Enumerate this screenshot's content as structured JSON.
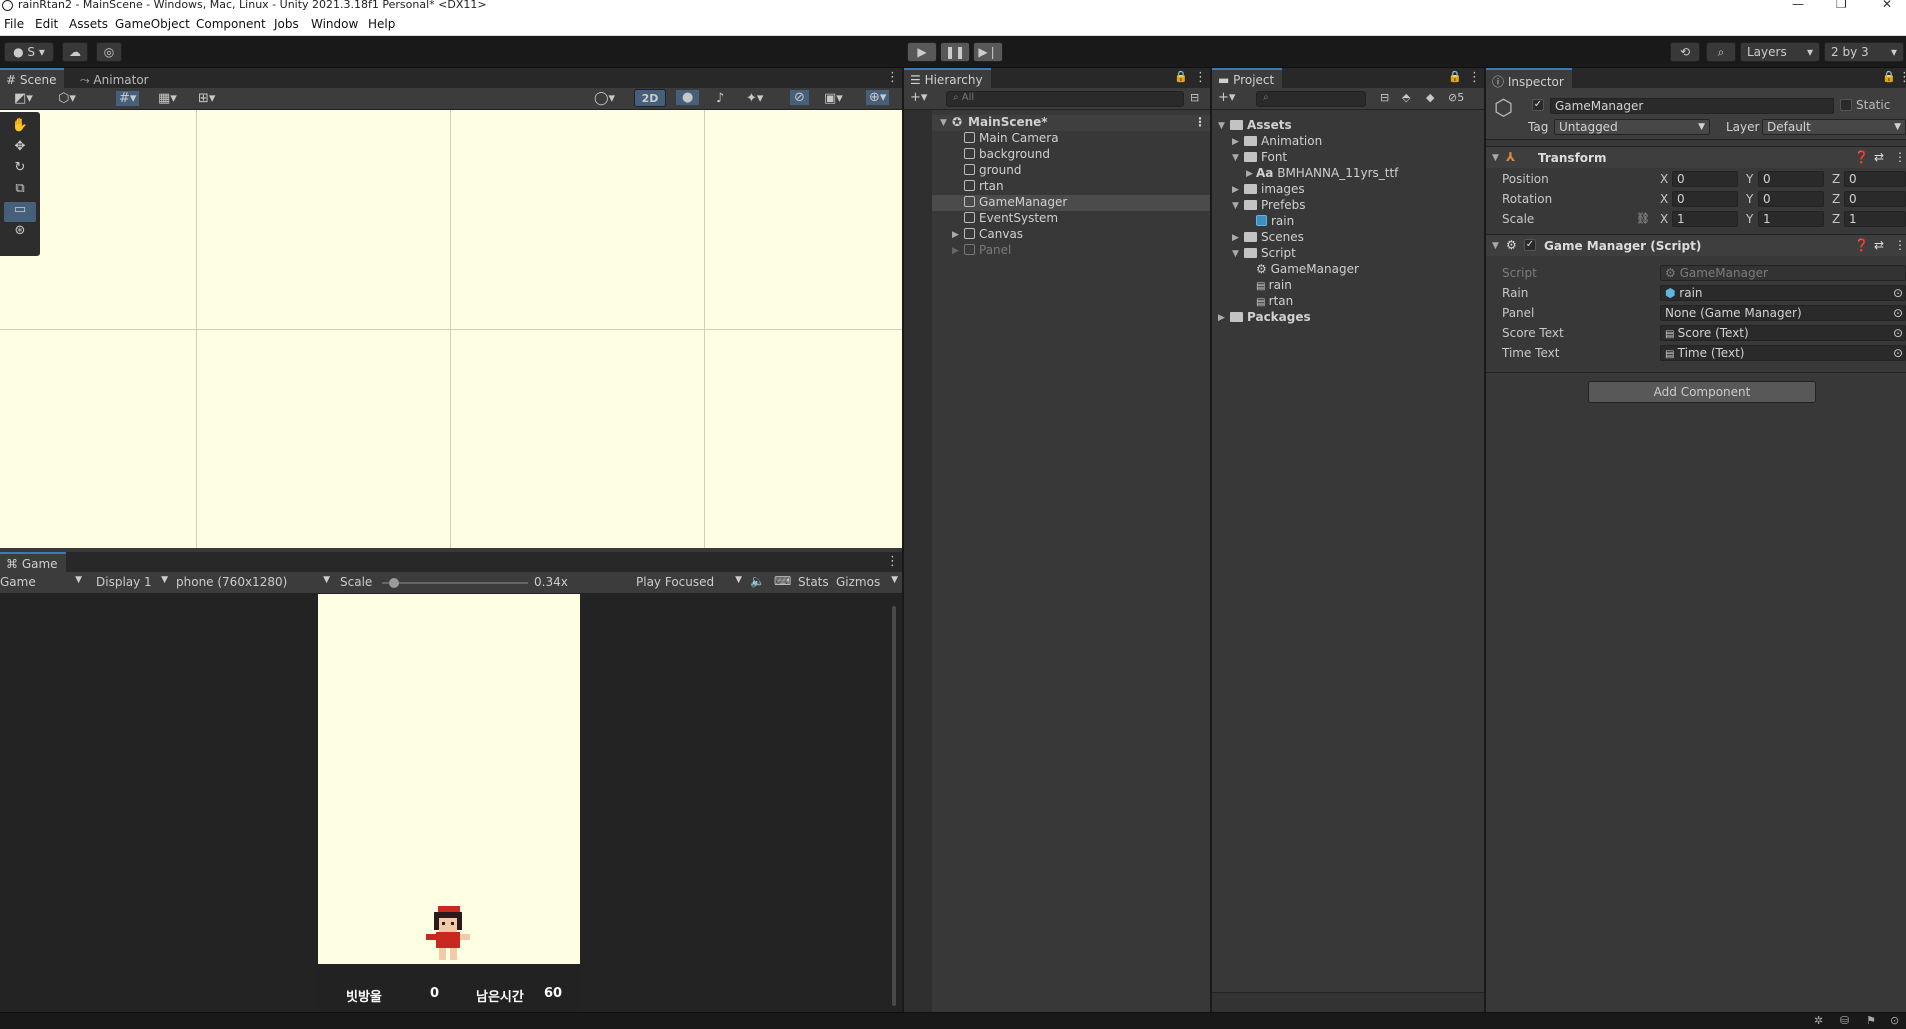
{
  "window": {
    "title": "rainRtan2 - MainScene - Windows, Mac, Linux - Unity 2021.3.18f1 Personal* <DX11>"
  },
  "menu": [
    "File",
    "Edit",
    "Assets",
    "GameObject",
    "Component",
    "Jobs",
    "Window",
    "Help"
  ],
  "toolbar": {
    "account": "S",
    "layers_label": "Layers",
    "layout_label": "2 by 3"
  },
  "scene": {
    "tab_scene": "Scene",
    "tab_animator": "Animator",
    "mode_2d": "2D"
  },
  "game": {
    "tab": "Game",
    "view_mode": "Game",
    "display": "Display 1",
    "resolution": "phone (760x1280)",
    "scale_label": "Scale",
    "scale_value": "0.34x",
    "scale_level": 0.05,
    "play_mode": "Play Focused",
    "stats": "Stats",
    "gizmos": "Gizmos",
    "hud": {
      "score_label": "빗방울",
      "score_value": "0",
      "time_label": "남은시간",
      "time_value": "60"
    }
  },
  "hierarchy": {
    "tab": "Hierarchy",
    "search_placeholder": "All",
    "scene": "MainScene*",
    "items": [
      {
        "label": "Main Camera"
      },
      {
        "label": "background"
      },
      {
        "label": "ground"
      },
      {
        "label": "rtan"
      },
      {
        "label": "GameManager"
      },
      {
        "label": "EventSystem"
      },
      {
        "label": "Canvas"
      },
      {
        "label": "Panel"
      }
    ]
  },
  "project": {
    "tab": "Project",
    "hidden_count": "5",
    "items": [
      {
        "label": "Assets"
      },
      {
        "label": "Animation"
      },
      {
        "label": "Font"
      },
      {
        "label": "BMHANNA_11yrs_ttf"
      },
      {
        "label": "images"
      },
      {
        "label": "Prefebs"
      },
      {
        "label": "rain"
      },
      {
        "label": "Scenes"
      },
      {
        "label": "Script"
      },
      {
        "label": "GameManager"
      },
      {
        "label": "rain"
      },
      {
        "label": "rtan"
      },
      {
        "label": "Packages"
      }
    ],
    "font_prefix": "Aa"
  },
  "inspector": {
    "tab": "Inspector",
    "object_name": "GameManager",
    "static_label": "Static",
    "tag_label": "Tag",
    "tag_value": "Untagged",
    "layer_label": "Layer",
    "layer_value": "Default",
    "transform": {
      "title": "Transform",
      "position_label": "Position",
      "rotation_label": "Rotation",
      "scale_label": "Scale",
      "x": "X",
      "y": "Y",
      "z": "Z",
      "position": [
        "0",
        "0",
        "0"
      ],
      "rotation": [
        "0",
        "0",
        "0"
      ],
      "scale": [
        "1",
        "1",
        "1"
      ]
    },
    "script_comp": {
      "title": "Game Manager (Script)",
      "fields": [
        {
          "label": "Script",
          "value": "GameManager"
        },
        {
          "label": "Rain",
          "value": "rain"
        },
        {
          "label": "Panel",
          "value": "None (Game Manager)"
        },
        {
          "label": "Score Text",
          "value": "Score (Text)"
        },
        {
          "label": "Time Text",
          "value": "Time (Text)"
        }
      ]
    },
    "add_component": "Add Component"
  }
}
